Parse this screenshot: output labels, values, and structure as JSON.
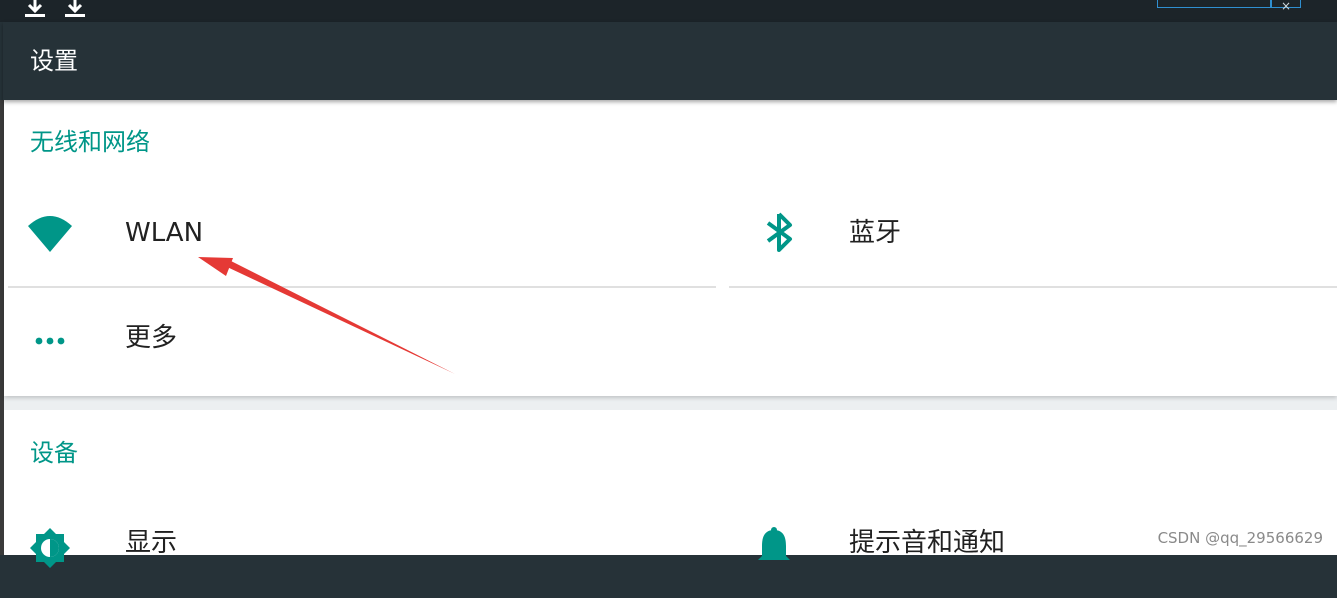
{
  "status_bar": {
    "icons": [
      "download-icon",
      "download-icon"
    ],
    "label": "",
    "close_glyph": "×"
  },
  "action_bar": {
    "title": "设置"
  },
  "sections": [
    {
      "header": "无线和网络",
      "items": [
        {
          "label": "WLAN",
          "icon": "wifi-icon"
        },
        {
          "label": "蓝牙",
          "icon": "bluetooth-icon"
        },
        {
          "label": "更多",
          "icon": "more-dots-icon"
        }
      ]
    },
    {
      "header": "设备",
      "items": [
        {
          "label": "显示",
          "icon": "display-brightness-icon"
        },
        {
          "label": "提示音和通知",
          "icon": "notification-bell-icon"
        }
      ]
    }
  ],
  "annotation": {
    "type": "arrow",
    "color": "#e53935",
    "points_to": "WLAN"
  },
  "watermark": "CSDN @qq_29566629",
  "colors": {
    "accent": "#009688",
    "action_bar": "#263238",
    "text": "#212121"
  }
}
